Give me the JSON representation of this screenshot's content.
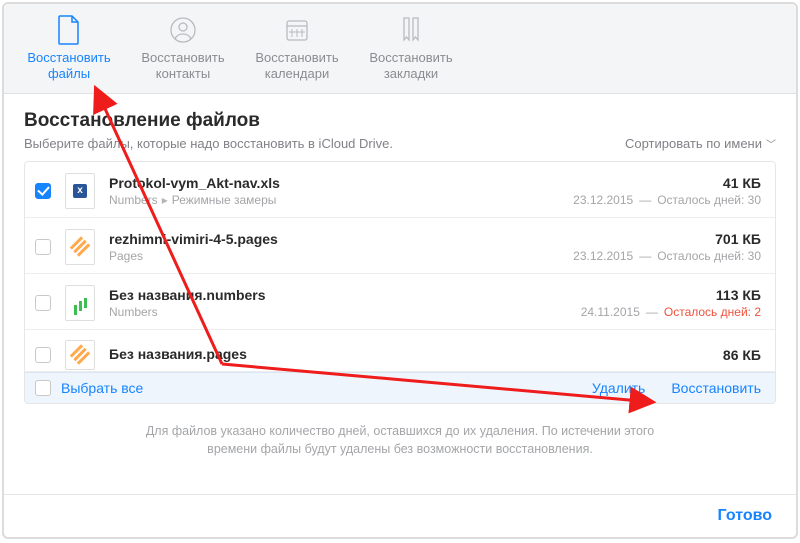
{
  "toolbar": {
    "items": [
      {
        "line1": "Восстановить",
        "line2": "файлы"
      },
      {
        "line1": "Восстановить",
        "line2": "контакты"
      },
      {
        "line1": "Восстановить",
        "line2": "календари"
      },
      {
        "line1": "Восстановить",
        "line2": "закладки"
      }
    ]
  },
  "content": {
    "heading": "Восстановление файлов",
    "prompt": "Выберите файлы, которые надо восстановить в iCloud Drive.",
    "sort_label": "Сортировать по имени"
  },
  "files": [
    {
      "name": "Protokol-vym_Akt-nav.xls",
      "app": "Numbers",
      "path": "Режимные замеры",
      "size": "41 КБ",
      "date": "23.12.2015",
      "remain": "Осталось дней: 30",
      "remain_low": false,
      "checked": true,
      "icon": "xls"
    },
    {
      "name": "rezhimni-vimiri-4-5.pages",
      "app": "Pages",
      "path": "",
      "size": "701 КБ",
      "date": "23.12.2015",
      "remain": "Осталось дней: 30",
      "remain_low": false,
      "checked": false,
      "icon": "pages"
    },
    {
      "name": "Без названия.numbers",
      "app": "Numbers",
      "path": "",
      "size": "113 КБ",
      "date": "24.11.2015",
      "remain": "Осталось дней: 2",
      "remain_low": true,
      "checked": false,
      "icon": "numbers"
    },
    {
      "name": "Без названия.pages",
      "app": "",
      "path": "",
      "size": "86 КБ",
      "date": "",
      "remain": "",
      "remain_low": false,
      "checked": false,
      "icon": "pages"
    }
  ],
  "list_actions": {
    "select_all": "Выбрать все",
    "delete": "Удалить",
    "restore": "Восстановить"
  },
  "hint": "Для файлов указано количество дней, оставшихся до их удаления. По истечении этого времени файлы будут удалены без возможности восстановления.",
  "footer": {
    "done": "Готово"
  }
}
